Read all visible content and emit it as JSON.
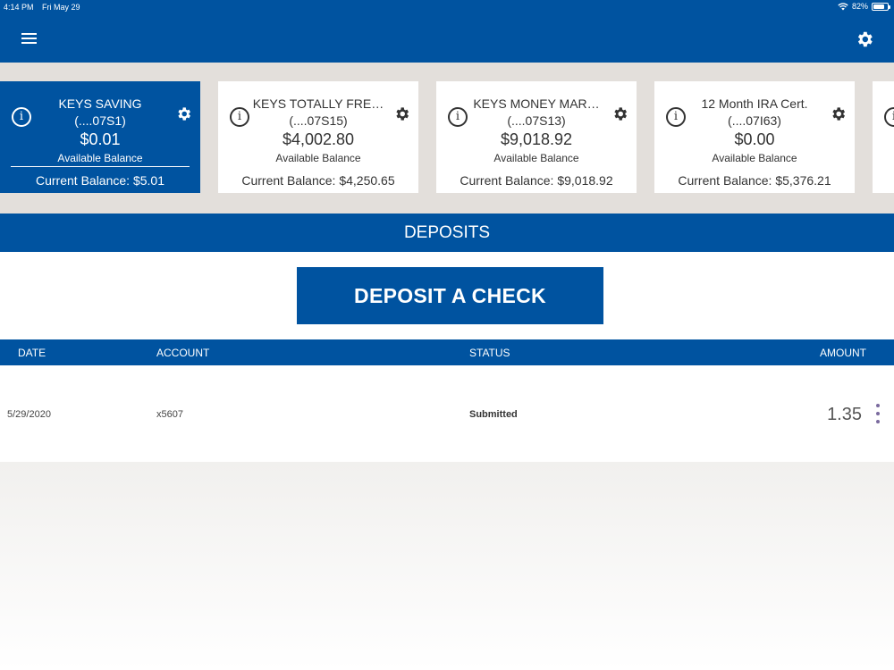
{
  "status_bar": {
    "time": "4:14 PM",
    "date": "Fri May 29",
    "battery": "82%",
    "battery_level": 0.82
  },
  "header": {
    "menu_icon": "hamburger-icon",
    "settings_icon": "gear-icon"
  },
  "accounts": [
    {
      "name": "KEYS SAVING",
      "number": "(....07S1)",
      "balance": "$0.01",
      "balance_label": "Available Balance",
      "current": "Current Balance: $5.01",
      "active": true
    },
    {
      "name": "KEYS TOTALLY FRE…",
      "number": "(....07S15)",
      "balance": "$4,002.80",
      "balance_label": "Available Balance",
      "current": "Current Balance: $4,250.65",
      "active": false
    },
    {
      "name": "KEYS MONEY MAR…",
      "number": "(....07S13)",
      "balance": "$9,018.92",
      "balance_label": "Available Balance",
      "current": "Current Balance: $9,018.92",
      "active": false
    },
    {
      "name": "12 Month IRA Cert.",
      "number": "(....07I63)",
      "balance": "$0.00",
      "balance_label": "Available Balance",
      "current": "Current Balance: $5,376.21",
      "active": false
    }
  ],
  "deposits": {
    "title": "DEPOSITS",
    "deposit_button": "DEPOSIT A CHECK",
    "columns": [
      "DATE",
      "ACCOUNT",
      "STATUS",
      "AMOUNT"
    ],
    "rows": [
      {
        "date": "5/29/2020",
        "account": "x5607",
        "status": "Submitted",
        "amount": "1.35"
      }
    ]
  },
  "colors": {
    "brand": "#0053a0",
    "strip": "#e3dfdb",
    "kebab": "#7a6a9e"
  }
}
